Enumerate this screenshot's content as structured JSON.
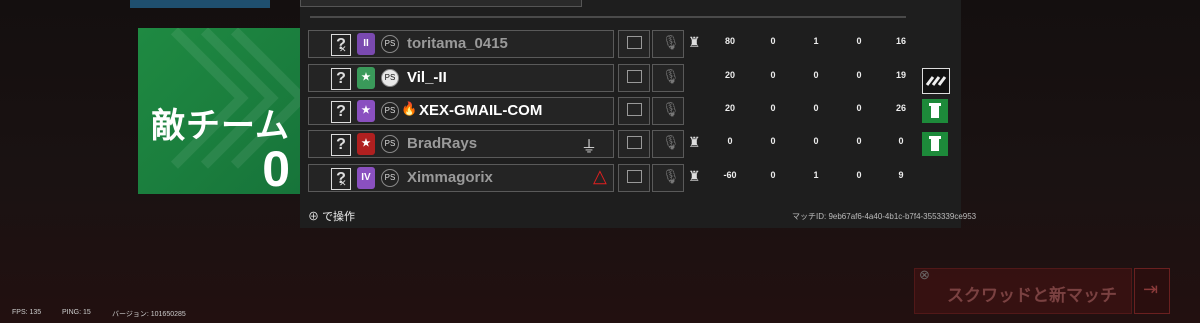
{
  "team": {
    "name": "敵チーム",
    "score": "0"
  },
  "players": [
    {
      "name": "toritama_0415",
      "rank": "II",
      "score": "80",
      "kills": "0",
      "assists": "1",
      "deaths": "0",
      "ping": "16",
      "badge_color": "#7a4ab0"
    },
    {
      "name": "Vil_-II",
      "rank": "★",
      "score": "20",
      "kills": "0",
      "assists": "0",
      "deaths": "0",
      "ping": "19",
      "badge_color": "#3a9a5a"
    },
    {
      "name": "XEX-GMAIL-COM",
      "rank": "★",
      "score": "20",
      "kills": "0",
      "assists": "0",
      "deaths": "0",
      "ping": "26",
      "badge_color": "#8a50c0"
    },
    {
      "name": "BradRays",
      "rank": "★",
      "score": "0",
      "kills": "0",
      "assists": "0",
      "deaths": "0",
      "ping": "0",
      "badge_color": "#b02020"
    },
    {
      "name": "Ximmagorix",
      "rank": "IV",
      "score": "-60",
      "kills": "0",
      "assists": "1",
      "deaths": "0",
      "ping": "9",
      "badge_color": "#8a50c0"
    }
  ],
  "footer": {
    "control_hint": "で操作",
    "match_id": "マッチID: 9eb67af6-4a40-4b1c-b7f4-3553339ce953"
  },
  "bottom": {
    "fps": "FPS: 135",
    "ping": "PING: 15",
    "version": "バージョン: 101650285"
  },
  "squad_button": {
    "label": "スクワッドと新マッチ"
  },
  "icons": {
    "chat": "chat-icon",
    "mic": "mic-muted-icon",
    "plug": "plug-icon",
    "warning": "warning-triangle-icon",
    "status": "status-icon"
  },
  "colors": {
    "team_green": "#1f8a42",
    "status_green": "#1d8a3a",
    "warning_red": "#e02020"
  }
}
